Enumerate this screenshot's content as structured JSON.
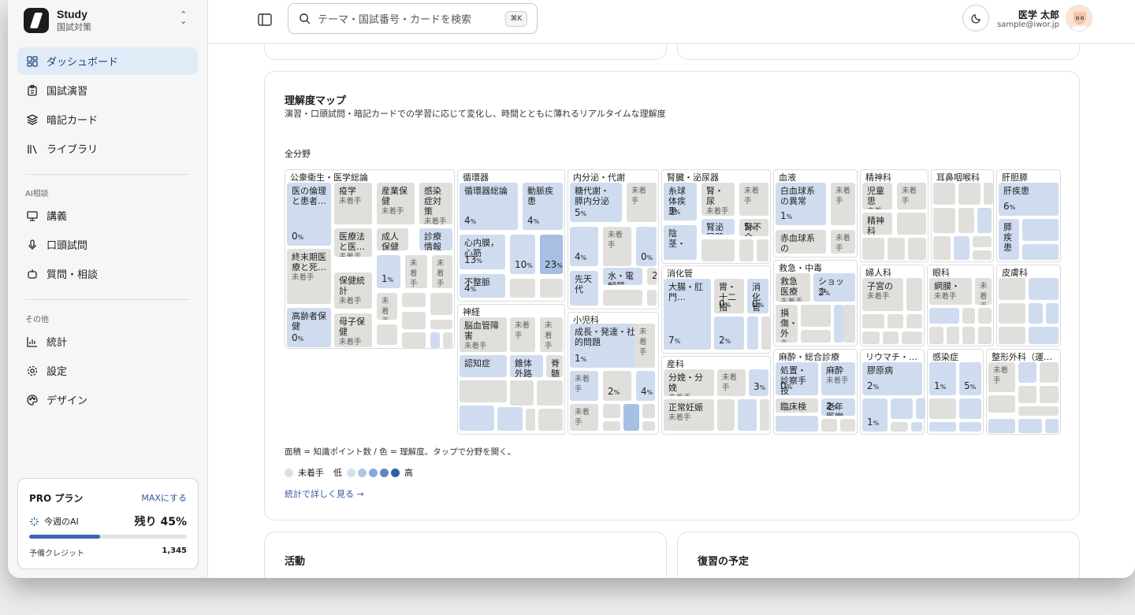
{
  "brand": {
    "name": "Study",
    "subtitle": "国試対策"
  },
  "nav": [
    {
      "label": "ダッシュボード",
      "icon": "dashboard-icon",
      "active": true
    },
    {
      "label": "国試演習",
      "icon": "clipboard-icon"
    },
    {
      "label": "暗記カード",
      "icon": "layers-icon"
    },
    {
      "label": "ライブラリ",
      "icon": "library-icon"
    }
  ],
  "ai_section": {
    "title": "AI相談",
    "items": [
      {
        "label": "講義",
        "icon": "presentation-icon"
      },
      {
        "label": "口頭試問",
        "icon": "microphone-icon"
      },
      {
        "label": "質問・相談",
        "icon": "bot-icon"
      }
    ]
  },
  "other_section": {
    "title": "その他",
    "items": [
      {
        "label": "統計",
        "icon": "bar-chart-icon"
      },
      {
        "label": "設定",
        "icon": "gear-icon"
      },
      {
        "label": "デザイン",
        "icon": "palette-icon"
      }
    ]
  },
  "plan": {
    "title": "PRO プラン",
    "upgrade": "MAXにする",
    "ai_label": "今週のAI",
    "remaining": "残り 45%",
    "progress": 0.45,
    "credit_label": "予備クレジット",
    "credit_value": "1,345"
  },
  "search": {
    "placeholder": "テーマ・国試番号・カードを検索",
    "shortcut": "⌘K"
  },
  "user": {
    "name": "医学 太郎",
    "email": "sample@iwor.jp"
  },
  "map": {
    "title": "理解度マップ",
    "subtitle": "演習・口頭試問・暗記カードでの学習に応じて変化し、時間とともに薄れるリアルタイムな理解度",
    "scope": "全分野",
    "caption": "面積 = 知識ポイント数 / 色 = 理解度。タップで分野を開く。",
    "legend_untouched": "未着手",
    "legend_low": "低",
    "legend_high": "高",
    "legend_colors": [
      "#d4e0f2",
      "#afc6e7",
      "#8aa9d9",
      "#5d84c4",
      "#2f5fa8"
    ],
    "link": "統計で詳しく見る →"
  },
  "sections": [
    {
      "label": "公衆衛生・医学総論",
      "cells": [
        {
          "name": "医の倫理と患者…",
          "pct": "0"
        },
        {
          "name": "疫学",
          "status": "未着手"
        },
        {
          "name": "産業保健",
          "status": "未着手"
        },
        {
          "name": "感染症対策",
          "status": "未着手"
        },
        {
          "name": "終末期医療と死…",
          "status": "未着手"
        },
        {
          "name": "医療法と医…",
          "status": "未着手"
        },
        {
          "name": "成人保健と",
          "status": ""
        },
        {
          "name": "診療情報と",
          "status": ""
        },
        {
          "name": "保健統計",
          "status": "未着手"
        },
        {
          "name": "",
          "pct": "1"
        },
        {
          "name": "",
          "status": "未着手"
        },
        {
          "name": "",
          "status": "未着手"
        },
        {
          "name": "高齢者保健",
          "pct": "0"
        },
        {
          "name": "母子保健",
          "status": "未着手"
        },
        {
          "name": "",
          "status": "未着手"
        }
      ]
    },
    {
      "label": "循環器",
      "cells": [
        {
          "name": "循環器総論",
          "pct": "4"
        },
        {
          "name": "動脈疾患",
          "pct": "4"
        },
        {
          "name": "心内膜，心筋",
          "pct": "13"
        },
        {
          "name": "",
          "pct": "10"
        },
        {
          "name": "",
          "pct": "23"
        },
        {
          "name": "不整脈",
          "pct": "4"
        }
      ]
    },
    {
      "label": "内分泌・代謝",
      "cells": [
        {
          "name": "糖代謝・膵内分泌",
          "pct": "5"
        },
        {
          "name": "",
          "status": "未着手"
        },
        {
          "name": "",
          "pct": "4"
        },
        {
          "name": "",
          "status": "未着手"
        },
        {
          "name": "",
          "pct": "0"
        },
        {
          "name": "水・電解質",
          "pct": ""
        },
        {
          "name": "",
          "pct": "2"
        },
        {
          "name": "先天代",
          "pct": ""
        }
      ]
    },
    {
      "label": "腎臓・泌尿器",
      "cells": [
        {
          "name": "糸球体疾患",
          "pct": "3"
        },
        {
          "name": "腎・尿",
          "status": "未着手"
        },
        {
          "name": "",
          "status": "未着手"
        },
        {
          "name": "腎泌尿器総論",
          "pct": ""
        },
        {
          "name": "腎不全",
          "pct": "5"
        },
        {
          "name": "陰茎・",
          "pct": ""
        }
      ]
    },
    {
      "label": "血液",
      "cells": [
        {
          "name": "白血球系の異常",
          "pct": "1"
        },
        {
          "name": "",
          "status": "未着手"
        },
        {
          "name": "赤血球系の",
          "pct": ""
        },
        {
          "name": "",
          "status": "未着手"
        }
      ]
    },
    {
      "label": "精神科",
      "cells": [
        {
          "name": "児童思",
          "status": "未着手"
        },
        {
          "name": "",
          "status": "未着手"
        },
        {
          "name": "精神科",
          "pct": ""
        }
      ]
    },
    {
      "label": "耳鼻咽喉科",
      "cells": []
    },
    {
      "label": "肝胆膵",
      "cells": [
        {
          "name": "肝疾患",
          "pct": "6"
        },
        {
          "name": "膵疾患",
          "pct": ""
        }
      ]
    },
    {
      "label": "救急・中毒",
      "cells": [
        {
          "name": "救急医療",
          "status": "未着手"
        },
        {
          "name": "ショック",
          "pct": "2"
        },
        {
          "name": "損傷・外",
          "status": "未着手"
        }
      ]
    },
    {
      "label": "婦人科",
      "cells": [
        {
          "name": "子宮の",
          "status": "未着手"
        }
      ]
    },
    {
      "label": "眼科",
      "cells": [
        {
          "name": "網膜・",
          "status": "未着手"
        },
        {
          "name": "",
          "status": "未着手"
        }
      ]
    },
    {
      "label": "皮膚科",
      "cells": []
    },
    {
      "label": "消化管",
      "cells": [
        {
          "name": "大腸・肛門…",
          "pct": "7"
        },
        {
          "name": "胃・十二指",
          "pct": "0"
        },
        {
          "name": "消化管総",
          "pct": "0"
        },
        {
          "name": "",
          "pct": "2"
        }
      ]
    },
    {
      "label": "神経",
      "cells": [
        {
          "name": "脳血管障害",
          "status": "未着手"
        },
        {
          "name": "",
          "status": "未着手"
        },
        {
          "name": "",
          "status": "未着手"
        },
        {
          "name": "認知症",
          "pct": ""
        },
        {
          "name": "錐体外路障害",
          "pct": ""
        },
        {
          "name": "脊髄・末梢",
          "pct": ""
        }
      ]
    },
    {
      "label": "小児科",
      "cells": [
        {
          "name": "成長・発達・社会的問題",
          "pct": "1"
        },
        {
          "name": "",
          "status": "未着手"
        },
        {
          "name": "",
          "pct": "2"
        },
        {
          "name": "",
          "status": "未着手"
        },
        {
          "name": "",
          "pct": "4"
        },
        {
          "name": "",
          "status": "未着手"
        }
      ]
    },
    {
      "label": "産科",
      "cells": [
        {
          "name": "分娩・分娩",
          "status": "未着手"
        },
        {
          "name": "",
          "status": "未着手"
        },
        {
          "name": "",
          "pct": "3"
        },
        {
          "name": "正常妊娠",
          "status": "未着手"
        }
      ]
    },
    {
      "label": "麻酔・総合診療",
      "cells": [
        {
          "name": "処置・診察手技",
          "pct": "0"
        },
        {
          "name": "麻酔",
          "status": "未着手"
        },
        {
          "name": "臨床検査関連",
          "pct": ""
        },
        {
          "name": "老年医学",
          "pct": "2"
        }
      ]
    },
    {
      "label": "リウマチ・…",
      "cells": [
        {
          "name": "膠原病",
          "pct": "2"
        },
        {
          "name": "",
          "pct": "1"
        }
      ]
    },
    {
      "label": "感染症",
      "cells": [
        {
          "name": "",
          "pct": "1"
        },
        {
          "name": "",
          "pct": "5"
        }
      ]
    },
    {
      "label": "整形外科（運…",
      "cells": [
        {
          "name": "",
          "status": "未着手"
        }
      ]
    }
  ],
  "cards": {
    "activity": "活動",
    "review": "復習の予定"
  }
}
